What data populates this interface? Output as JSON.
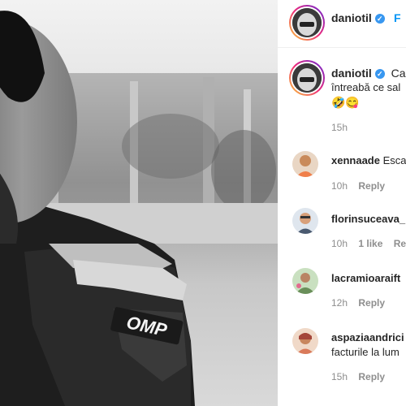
{
  "post": {
    "author": "daniotil",
    "follow_label": "F",
    "caption_line1": "Can",
    "caption_line2": "întreabă ce sal",
    "caption_emoji": "🤣😋",
    "caption_time": "15h",
    "photo_logo": "OMP"
  },
  "comments": [
    {
      "username": "xennaade",
      "text": "Esca",
      "time": "10h",
      "likes": "",
      "reply": "Reply"
    },
    {
      "username": "florinsuceava_",
      "text": "",
      "time": "10h",
      "likes": "1 like",
      "reply": "Rep"
    },
    {
      "username": "lacramioaraift",
      "text": "",
      "time": "12h",
      "likes": "",
      "reply": "Reply"
    },
    {
      "username": "aspaziaandrici",
      "text": "facturile la lum",
      "time": "15h",
      "likes": "",
      "reply": "Reply"
    }
  ],
  "colors": {
    "accent": "#0095f6",
    "verified": "#3897f0",
    "meta": "#8e8e8e"
  },
  "icons": {
    "verified": "verified-badge-icon"
  }
}
